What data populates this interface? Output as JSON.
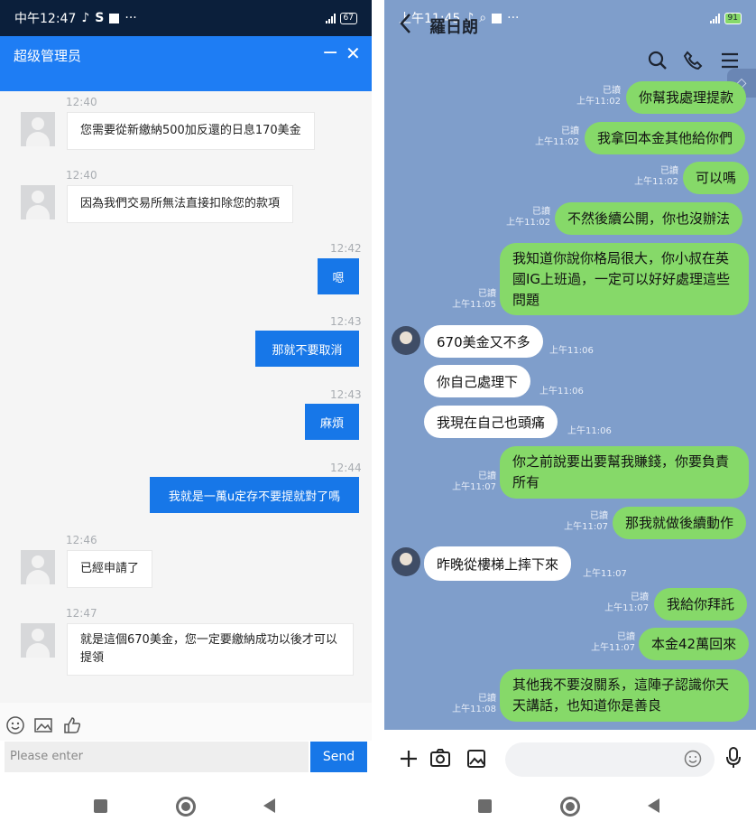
{
  "left": {
    "status_time": "中午12:47",
    "battery": "67",
    "title": "超级管理员",
    "minimize": "−",
    "close": "✕",
    "messages": [
      {
        "side": "in",
        "time": "12:40",
        "text": "您需要從新繳納500加反還的日息170美金"
      },
      {
        "side": "in",
        "time": "12:40",
        "text": "因為我們交易所無法直接扣除您的款項"
      },
      {
        "side": "out",
        "time": "12:42",
        "text": "嗯"
      },
      {
        "side": "out",
        "time": "12:43",
        "text": "那就不要取消"
      },
      {
        "side": "out",
        "time": "12:43",
        "text": "麻煩"
      },
      {
        "side": "out",
        "time": "12:44",
        "text": "我就是一萬u定存不要提就對了嗎"
      },
      {
        "side": "in",
        "time": "12:46",
        "text": "已經申請了"
      },
      {
        "side": "in",
        "time": "12:47",
        "text": "就是這個670美金，您一定要繳納成功以後才可以提領"
      }
    ],
    "input_placeholder": "Please enter",
    "send_label": "Send"
  },
  "right": {
    "status_time": "上午11:45",
    "battery": "91",
    "contact_name": "羅日朗",
    "read_label": "已讀",
    "messages": [
      {
        "side": "out",
        "time": "上午11:02",
        "text": "你幫我處理提款"
      },
      {
        "side": "out",
        "time": "上午11:02",
        "text": "我拿回本金其他給你們"
      },
      {
        "side": "out",
        "time": "上午11:02",
        "text": "可以嗎"
      },
      {
        "side": "out",
        "time": "上午11:02",
        "text": "不然後續公開，你也沒辦法"
      },
      {
        "side": "out",
        "time": "上午11:05",
        "text": "我知道你說你格局很大，你小叔在英國IG上班過，一定可以好好處理這些問題"
      },
      {
        "side": "in",
        "time": "上午11:06",
        "text": "670美金又不多"
      },
      {
        "side": "in",
        "time": "上午11:06",
        "text": "你自己處理下"
      },
      {
        "side": "in",
        "time": "上午11:06",
        "text": "我現在自己也頭痛"
      },
      {
        "side": "out",
        "time": "上午11:07",
        "text": "你之前說要出要幫我賺錢，你要負責所有"
      },
      {
        "side": "out",
        "time": "上午11:07",
        "text": "那我就做後續動作"
      },
      {
        "side": "in",
        "time": "上午11:07",
        "text": "昨晚從樓梯上摔下來"
      },
      {
        "side": "out",
        "time": "上午11:07",
        "text": "我給你拜託"
      },
      {
        "side": "out",
        "time": "上午11:07",
        "text": "本金42萬回來"
      },
      {
        "side": "out",
        "time": "上午11:08",
        "text": "其他我不要沒關系，這陣子認識你天天講話，也知道你是善良"
      }
    ]
  },
  "icons": [
    "smile-icon",
    "image-icon",
    "thumbs-up-icon",
    "search-icon",
    "phone-icon",
    "menu-icon",
    "back-arrow-icon",
    "plus-icon",
    "camera-icon",
    "gallery-icon",
    "mic-icon"
  ],
  "colors": {
    "left_header": "#1e7df4",
    "left_out_bubble": "#1777e8",
    "right_bg": "#7f9ecb",
    "right_out_bubble": "#86d969"
  }
}
